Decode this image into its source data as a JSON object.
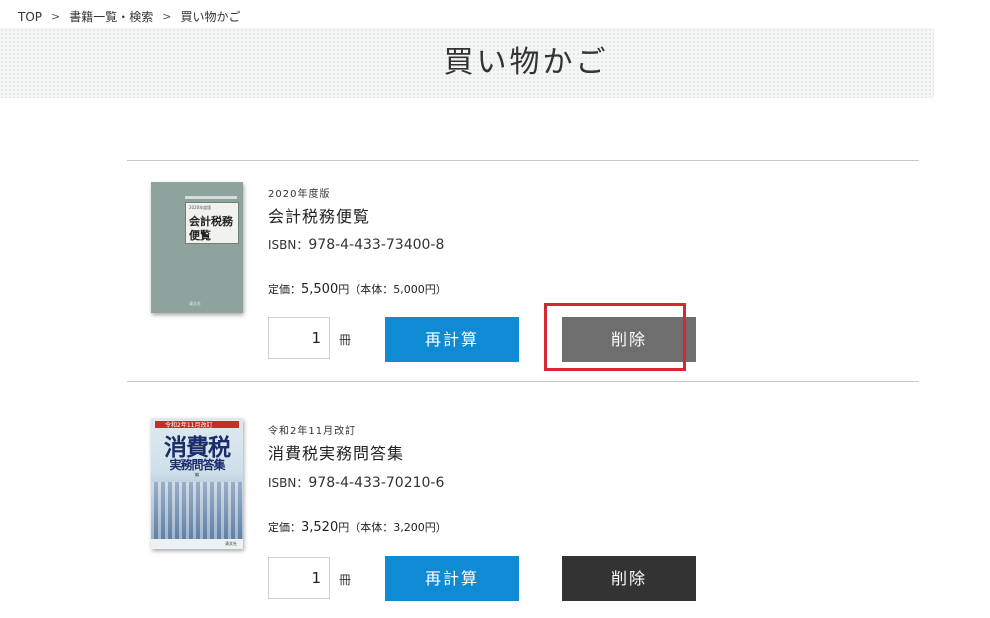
{
  "breadcrumb": {
    "items": [
      {
        "label": "TOP"
      },
      {
        "label": "書籍一覧・検索"
      },
      {
        "label": "買い物かご"
      }
    ],
    "separator": ">"
  },
  "page": {
    "title": "買い物かご"
  },
  "cart": {
    "items": [
      {
        "edition": "2020年度版",
        "title": "会計税務便覧",
        "isbn_label": "ISBN：",
        "isbn": "978-4-433-73400-8",
        "price_label": "定価：",
        "price": "5,500",
        "currency": "円",
        "price_sub": "（本体：5,000円）",
        "quantity": "1",
        "unit": "冊",
        "recalc_label": "再計算",
        "delete_label": "削除",
        "cover": {
          "header": "2020年度版",
          "title_line1": "会計税務",
          "title_line2": "便覧",
          "top_text": "日本税理士会連合会編",
          "publisher": "清文社"
        }
      },
      {
        "edition": "令和2年11月改訂",
        "title": "消費税実務問答集",
        "isbn_label": "ISBN：",
        "isbn": "978-4-433-70210-6",
        "price_label": "定価：",
        "price": "3,520",
        "currency": "円",
        "price_sub": "（本体：3,200円）",
        "quantity": "1",
        "unit": "冊",
        "recalc_label": "再計算",
        "delete_label": "削除",
        "cover": {
          "band": "令和2年11月改訂",
          "title_line1": "消費税",
          "title_line2": "実務問答集",
          "author": "編",
          "publisher": "清文社"
        }
      }
    ]
  },
  "colors": {
    "recalc_button": "#0f8bd3",
    "delete_button_highlighted": "#6e6e6e",
    "delete_button": "#333333",
    "highlight_box": "#d62834"
  }
}
